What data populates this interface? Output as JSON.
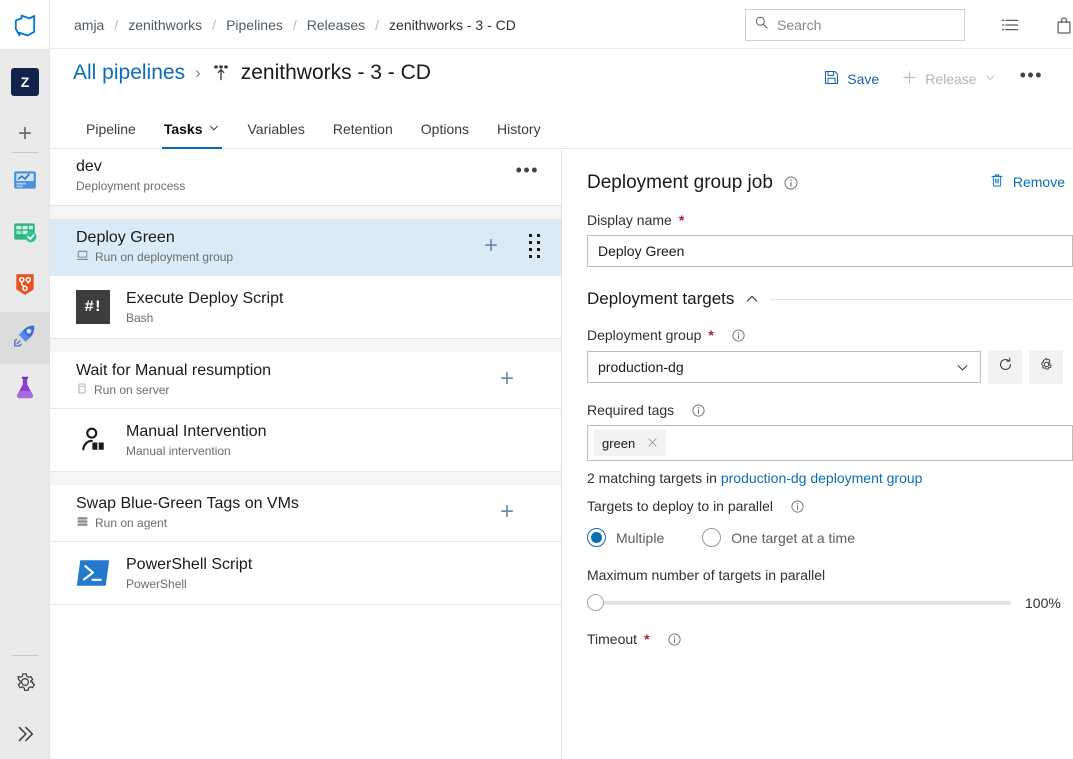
{
  "rail": {
    "logo_icon": "azure-devops-logo-icon",
    "project_initial": "Z",
    "new_label": "+",
    "items": [
      {
        "name": "overview",
        "icon": "overview-icon",
        "active": false
      },
      {
        "name": "boards",
        "icon": "boards-icon",
        "active": false
      },
      {
        "name": "repos",
        "icon": "repos-icon",
        "active": false
      },
      {
        "name": "pipelines",
        "icon": "pipelines-rocket-icon",
        "active": true
      },
      {
        "name": "test-plans",
        "icon": "test-plans-flask-icon",
        "active": false
      }
    ],
    "settings_icon": "gear-icon",
    "expand_icon": "double-chevron-right-icon"
  },
  "topbar": {
    "breadcrumbs": [
      "amja",
      "zenithworks",
      "Pipelines",
      "Releases",
      "zenithworks - 3 - CD"
    ],
    "separator": "/",
    "search": {
      "placeholder": "Search",
      "value": "",
      "icon": "search-icon"
    },
    "actions": [
      {
        "name": "work-items-icon",
        "icon": "list-icon"
      },
      {
        "name": "marketplace-icon",
        "icon": "bag-icon"
      }
    ]
  },
  "header": {
    "all_pipelines": "All pipelines",
    "chevron": "›",
    "title_icon": "release-pipeline-icon",
    "title": "zenithworks - 3 - CD",
    "save_label": "Save",
    "save_icon": "save-icon",
    "release_label": "Release",
    "release_icon": "plus-icon",
    "release_chevron": "chevron-down-icon",
    "more_label": "•••"
  },
  "tabs": [
    {
      "label": "Pipeline",
      "active": false,
      "chevron": false
    },
    {
      "label": "Tasks",
      "active": true,
      "chevron": true
    },
    {
      "label": "Variables",
      "active": false,
      "chevron": false
    },
    {
      "label": "Retention",
      "active": false,
      "chevron": false
    },
    {
      "label": "Options",
      "active": false,
      "chevron": false
    },
    {
      "label": "History",
      "active": false,
      "chevron": false
    }
  ],
  "task_panel": {
    "process": {
      "name": "dev",
      "subtitle": "Deployment process",
      "more_label": "•••"
    },
    "groups": [
      {
        "phase": {
          "name": "Deploy Green",
          "subtitle": "Run on deployment group",
          "subtitle_icon": "deployment-group-icon",
          "selected": true,
          "add_label": "+",
          "has_drag_handle": true
        },
        "tasks": [
          {
            "name": "Execute Deploy Script",
            "subtitle": "Bash",
            "icon": "bash-icon",
            "icon_text": "#!"
          }
        ]
      },
      {
        "phase": {
          "name": "Wait for Manual resumption",
          "subtitle": "Run on server",
          "subtitle_icon": "server-icon",
          "selected": false,
          "add_label": "+",
          "has_drag_handle": false
        },
        "tasks": [
          {
            "name": "Manual Intervention",
            "subtitle": "Manual intervention",
            "icon": "manual-intervention-icon",
            "icon_text": ""
          }
        ]
      },
      {
        "phase": {
          "name": "Swap Blue-Green Tags on VMs",
          "subtitle": "Run on agent",
          "subtitle_icon": "agent-icon",
          "selected": false,
          "add_label": "+",
          "has_drag_handle": false
        },
        "tasks": [
          {
            "name": "PowerShell Script",
            "subtitle": "PowerShell",
            "icon": "powershell-icon",
            "icon_text": ""
          }
        ]
      }
    ]
  },
  "detail": {
    "title": "Deployment group job",
    "title_info_icon": "info-icon",
    "remove_label": "Remove",
    "remove_icon": "trash-icon",
    "display_name": {
      "label": "Display name",
      "required_mark": "*",
      "value": "Deploy Green"
    },
    "section": {
      "title": "Deployment targets",
      "collapse_icon": "chevron-up-icon"
    },
    "deployment_group": {
      "label": "Deployment group",
      "required_mark": "*",
      "info_icon": "info-icon",
      "value": "production-dg",
      "chevron": "chevron-down-icon",
      "refresh_icon": "refresh-icon",
      "manage_icon": "gear-icon"
    },
    "required_tags": {
      "label": "Required tags",
      "info_icon": "info-icon",
      "tags": [
        {
          "text": "green",
          "remove_icon": "close-icon"
        }
      ],
      "match_prefix": "2 matching targets in ",
      "match_link": "production-dg deployment group"
    },
    "parallel": {
      "label": "Targets to deploy to in parallel",
      "info_icon": "info-icon",
      "options": [
        {
          "label": "Multiple",
          "selected": true
        },
        {
          "label": "One target at a time",
          "selected": false
        }
      ]
    },
    "max_parallel": {
      "label": "Maximum number of targets in parallel",
      "value_label": "100%",
      "slider_position_pct": 0
    },
    "timeout": {
      "label": "Timeout",
      "required_mark": "*",
      "info_icon": "info-icon"
    }
  },
  "colors": {
    "accent": "#0b6db5",
    "selected_row": "#dbeaf7",
    "required_red": "#a4262c",
    "rail_bg": "#eaeaea"
  }
}
